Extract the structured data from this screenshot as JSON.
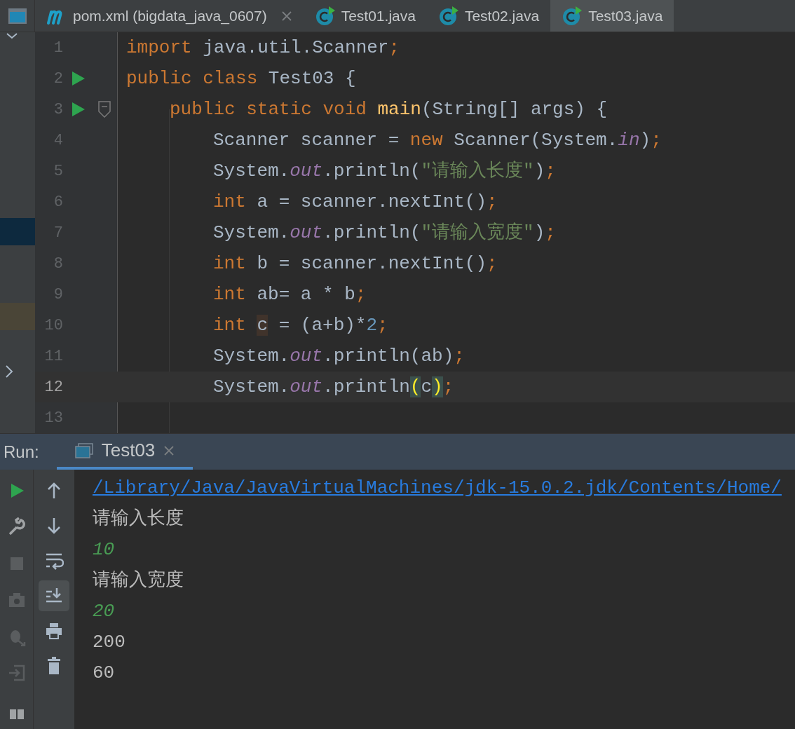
{
  "tabs": [
    {
      "label": "pom.xml (bigdata_java_0607)",
      "kind": "maven",
      "selected": false,
      "closable": true
    },
    {
      "label": "Test01.java",
      "kind": "java",
      "selected": false,
      "closable": false
    },
    {
      "label": "Test02.java",
      "kind": "java",
      "selected": false,
      "closable": false
    },
    {
      "label": "Test03.java",
      "kind": "java",
      "selected": true,
      "closable": false
    }
  ],
  "editor": {
    "lines": [
      {
        "number": "1",
        "current": false,
        "tokens": [
          {
            "text": "import ",
            "kind": "keyword"
          },
          {
            "text": "java.util.Scanner",
            "kind": "plain"
          },
          {
            "text": ";",
            "kind": "keyword"
          }
        ]
      },
      {
        "number": "2",
        "current": false,
        "gutter_icons": [
          {
            "kind": "run"
          }
        ],
        "tokens": [
          {
            "text": "public class ",
            "kind": "keyword"
          },
          {
            "text": "Test03 {",
            "kind": "plain"
          }
        ],
        "children": [
          {
            "number": "3",
            "current": false,
            "gutter_icons": [
              {
                "kind": "run"
              },
              {
                "kind": "fold"
              }
            ],
            "tokens": [
              {
                "text": "public static void ",
                "kind": "keyword"
              },
              {
                "text": "main",
                "kind": "method"
              },
              {
                "text": "(String[] args) {",
                "kind": "plain"
              }
            ],
            "children": [
              {
                "number": "4",
                "current": false,
                "tokens": [
                  {
                    "text": "Scanner scanner = ",
                    "kind": "plain"
                  },
                  {
                    "text": "new ",
                    "kind": "keyword"
                  },
                  {
                    "text": "Scanner(System.",
                    "kind": "plain"
                  },
                  {
                    "text": "in",
                    "kind": "static"
                  },
                  {
                    "text": ")",
                    "kind": "plain"
                  },
                  {
                    "text": ";",
                    "kind": "keyword"
                  }
                ]
              },
              {
                "number": "5",
                "current": false,
                "tokens": [
                  {
                    "text": "System.",
                    "kind": "plain"
                  },
                  {
                    "text": "out",
                    "kind": "static"
                  },
                  {
                    "text": ".println(",
                    "kind": "plain"
                  },
                  {
                    "text": "\"请输入长度\"",
                    "kind": "string"
                  },
                  {
                    "text": ")",
                    "kind": "plain"
                  },
                  {
                    "text": ";",
                    "kind": "keyword"
                  }
                ]
              },
              {
                "number": "6",
                "current": false,
                "tokens": [
                  {
                    "text": "int ",
                    "kind": "keyword"
                  },
                  {
                    "text": "a = scanner.nextInt()",
                    "kind": "plain"
                  },
                  {
                    "text": ";",
                    "kind": "keyword"
                  }
                ]
              },
              {
                "number": "7",
                "current": false,
                "tokens": [
                  {
                    "text": "System.",
                    "kind": "plain"
                  },
                  {
                    "text": "out",
                    "kind": "static"
                  },
                  {
                    "text": ".println(",
                    "kind": "plain"
                  },
                  {
                    "text": "\"请输入宽度\"",
                    "kind": "string"
                  },
                  {
                    "text": ")",
                    "kind": "plain"
                  },
                  {
                    "text": ";",
                    "kind": "keyword"
                  }
                ]
              },
              {
                "number": "8",
                "current": false,
                "tokens": [
                  {
                    "text": "int ",
                    "kind": "keyword"
                  },
                  {
                    "text": "b = scanner.nextInt()",
                    "kind": "plain"
                  },
                  {
                    "text": ";",
                    "kind": "keyword"
                  }
                ]
              },
              {
                "number": "9",
                "current": false,
                "tokens": [
                  {
                    "text": "int ",
                    "kind": "keyword"
                  },
                  {
                    "text": "ab= a * b",
                    "kind": "plain"
                  },
                  {
                    "text": ";",
                    "kind": "keyword"
                  }
                ]
              },
              {
                "number": "10",
                "current": false,
                "tokens": [
                  {
                    "text": "int ",
                    "kind": "keyword"
                  },
                  {
                    "text": "c",
                    "kind": "usage"
                  },
                  {
                    "text": " = (a+b)*",
                    "kind": "plain"
                  },
                  {
                    "text": "2",
                    "kind": "number"
                  },
                  {
                    "text": ";",
                    "kind": "keyword"
                  }
                ]
              },
              {
                "number": "11",
                "current": false,
                "tokens": [
                  {
                    "text": "System.",
                    "kind": "plain"
                  },
                  {
                    "text": "out",
                    "kind": "static"
                  },
                  {
                    "text": ".println(ab)",
                    "kind": "plain"
                  },
                  {
                    "text": ";",
                    "kind": "keyword"
                  }
                ]
              },
              {
                "number": "12",
                "current": true,
                "tokens": [
                  {
                    "text": "System.",
                    "kind": "plain"
                  },
                  {
                    "text": "out",
                    "kind": "static"
                  },
                  {
                    "text": ".println",
                    "kind": "plain"
                  },
                  {
                    "text": "(",
                    "kind": "brace"
                  },
                  {
                    "text": "c",
                    "kind": "plain"
                  },
                  {
                    "text": ")",
                    "kind": "brace"
                  },
                  {
                    "text": ";",
                    "kind": "keyword"
                  }
                ]
              }
            ]
          }
        ]
      },
      {
        "number": "13",
        "current": false
      }
    ]
  },
  "run_panel": {
    "label": "Run:",
    "tab": {
      "label": "Test03",
      "selected": true
    },
    "console": [
      {
        "text": "/Library/Java/JavaVirtualMachines/jdk-15.0.2.jdk/Contents/Home/",
        "kind": "link"
      },
      {
        "text": "请输入长度",
        "kind": "output"
      },
      {
        "text": "10",
        "kind": "input"
      },
      {
        "text": "请输入宽度",
        "kind": "output"
      },
      {
        "text": "20",
        "kind": "input"
      },
      {
        "text": "200",
        "kind": "output"
      },
      {
        "text": "60",
        "kind": "output"
      }
    ],
    "scroll_to_end": {
      "selected": true
    }
  }
}
